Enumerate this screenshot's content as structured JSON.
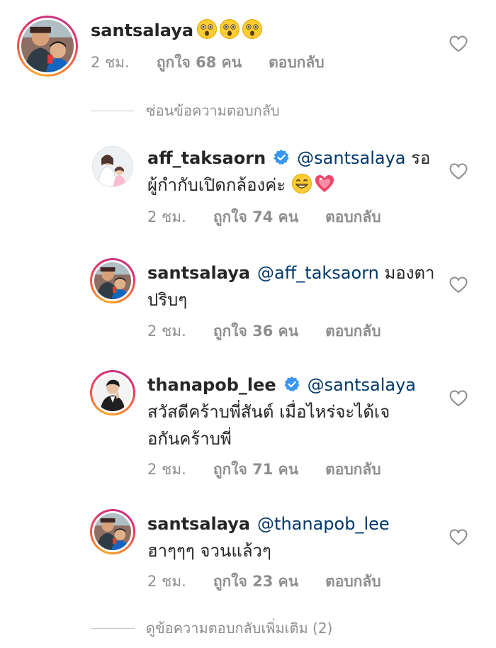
{
  "top_comment": {
    "username": "santsalaya",
    "emojis": [
      "astonished-face",
      "astonished-face",
      "astonished-face"
    ],
    "time": "2 ชม.",
    "likes": "ถูกใจ 68 คน",
    "reply": "ตอบกลับ"
  },
  "hide_replies_label": "ซ่อนข้อความตอบกลับ",
  "replies": [
    {
      "username": "aff_taksaorn",
      "verified": true,
      "mention": "@santsalaya",
      "text_line1": " รอ",
      "text_line2": "ผู้กำกับเปิดกล้องค่ะ",
      "emojis": [
        "grinning-face",
        "sparkling-heart"
      ],
      "time": "2 ชม.",
      "likes": "ถูกใจ 74 คน",
      "reply": "ตอบกลับ"
    },
    {
      "username": "santsalaya",
      "verified": false,
      "mention": "@aff_taksaorn",
      "text_line1": " มองตา",
      "text_line2": "ปริบๆ",
      "time": "2 ชม.",
      "likes": "ถูกใจ 36 คน",
      "reply": "ตอบกลับ"
    },
    {
      "username": "thanapob_lee",
      "verified": true,
      "mention": "@santsalaya",
      "text_line1": "",
      "text_line2": "สวัสดีคร้าบพี่สันต์ เมื่อไหร่จะได้เจ",
      "text_line3": "อกันคร้าบพี่",
      "time": "2 ชม.",
      "likes": "ถูกใจ 71 คน",
      "reply": "ตอบกลับ"
    },
    {
      "username": "santsalaya",
      "verified": false,
      "mention": "@thanapob_lee",
      "text_line1": "",
      "text_line2": "ฮาๆๆๆ จวนแล้วๆ",
      "time": "2 ชม.",
      "likes": "ถูกใจ 23 คน",
      "reply": "ตอบกลับ"
    }
  ],
  "view_more_label": "ดูข้อความตอบกลับเพิ่มเติม (2)",
  "colors": {
    "text": "#262626",
    "secondary": "#8e8e8e",
    "mention": "#00376b",
    "verified": "#3897f0",
    "divider": "#c7c7c7"
  }
}
